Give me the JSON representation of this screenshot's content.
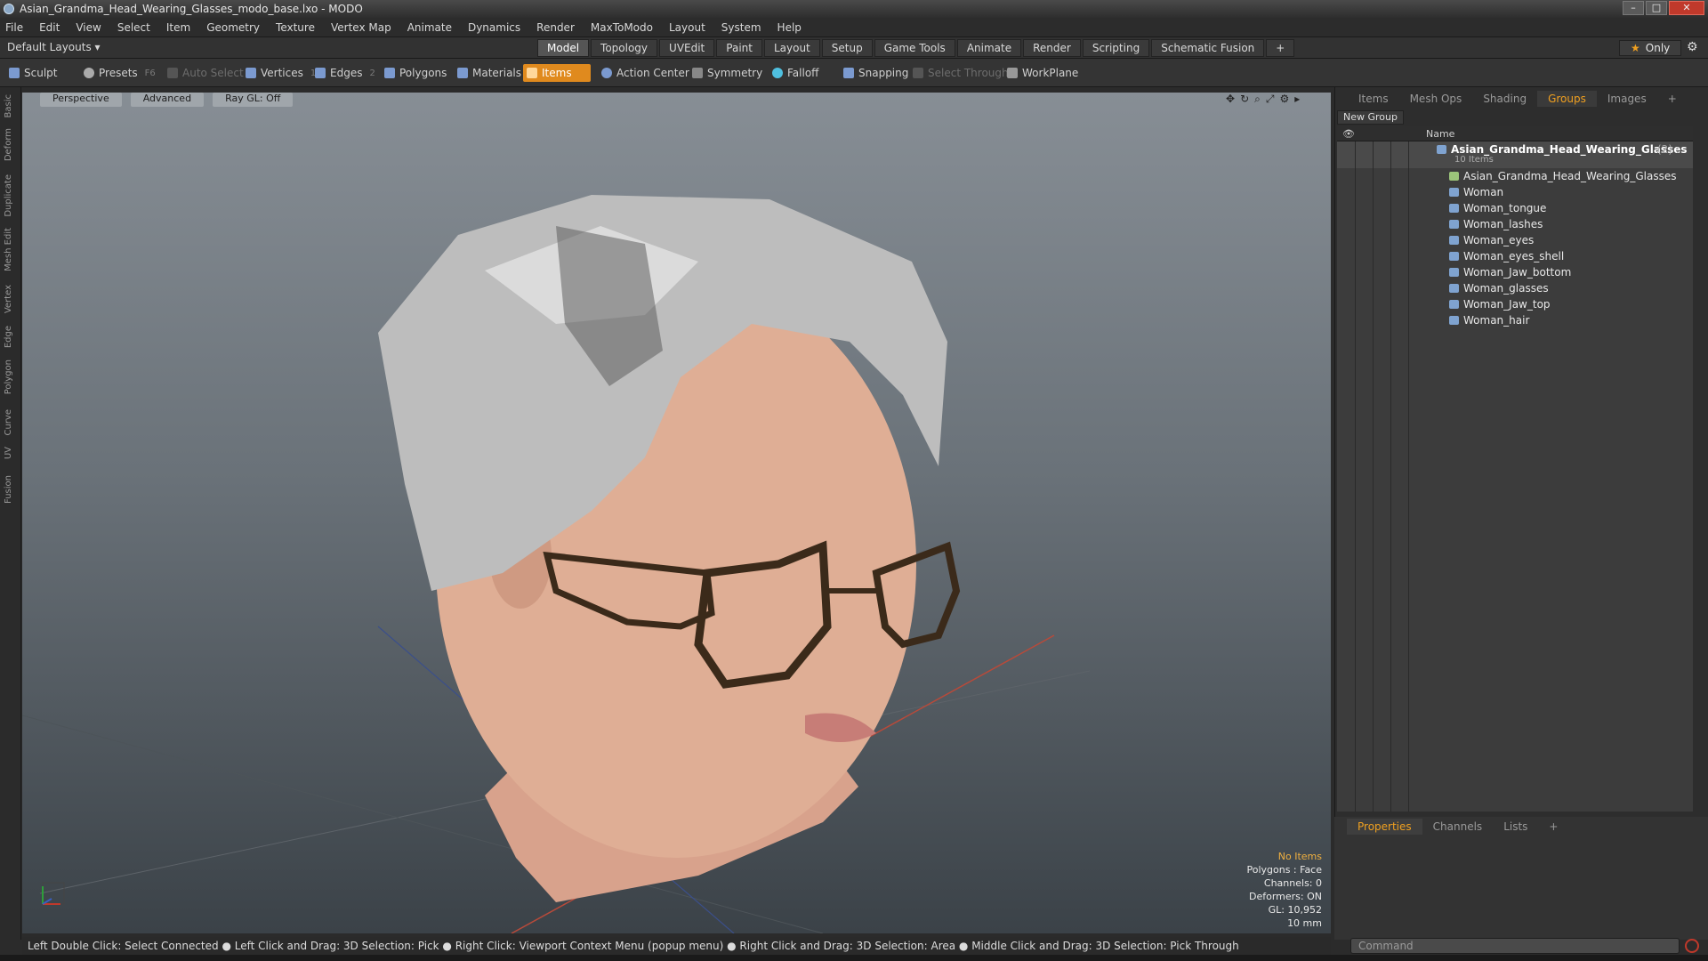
{
  "window": {
    "title": "Asian_Grandma_Head_Wearing_Glasses_modo_base.lxo - MODO"
  },
  "menu": [
    "File",
    "Edit",
    "View",
    "Select",
    "Item",
    "Geometry",
    "Texture",
    "Vertex Map",
    "Animate",
    "Dynamics",
    "Render",
    "MaxToModo",
    "Layout",
    "System",
    "Help"
  ],
  "layout": {
    "dropdown": "Default Layouts ▾",
    "tabs": [
      "Model",
      "Topology",
      "UVEdit",
      "Paint",
      "Layout",
      "Setup",
      "Game Tools",
      "Animate",
      "Render",
      "Scripting",
      "Schematic Fusion"
    ],
    "active_tab": "Model",
    "only_label": "Only"
  },
  "toolbar": {
    "sculpt": "Sculpt",
    "presets": "Presets",
    "presets_key": "F6",
    "auto_select": "Auto Select",
    "vertices": "Vertices",
    "vertices_key": "1",
    "edges": "Edges",
    "edges_key": "2",
    "polygons": "Polygons",
    "materials": "Materials",
    "items": "Items",
    "action_center": "Action Center",
    "symmetry": "Symmetry",
    "falloff": "Falloff",
    "snapping": "Snapping",
    "select_through": "Select Through",
    "workplane": "WorkPlane"
  },
  "left_tabs": [
    "Basic",
    "Deform",
    "Duplicate",
    "Mesh Edit",
    "Vertex",
    "Edge",
    "Polygon",
    "Curve",
    "UV",
    "Fusion"
  ],
  "viewport": {
    "view": "Perspective",
    "shading": "Advanced",
    "raygl": "Ray GL: Off",
    "stats": {
      "no_items": "No Items",
      "polygons": "Polygons : Face",
      "channels": "Channels: 0",
      "deformers": "Deformers: ON",
      "gl": "GL: 10,952",
      "unit": "10 mm"
    }
  },
  "right_panel": {
    "tabs": [
      "Items",
      "Mesh Ops",
      "Shading",
      "Groups",
      "Images"
    ],
    "active_tab": "Groups",
    "new_group": "New Group",
    "column_name": "Name",
    "group": {
      "name": "Asian_Grandma_Head_Wearing_Glasses",
      "count": "(2) :",
      "sub": "10 Items"
    },
    "items": [
      "Asian_Grandma_Head_Wearing_Glasses",
      "Woman",
      "Woman_tongue",
      "Woman_lashes",
      "Woman_eyes",
      "Woman_eyes_shell",
      "Woman_Jaw_bottom",
      "Woman_glasses",
      "Woman_Jaw_top",
      "Woman_hair"
    ]
  },
  "props_panel": {
    "tabs": [
      "Properties",
      "Channels",
      "Lists"
    ],
    "active_tab": "Properties"
  },
  "statusbar": "Left Double Click: Select Connected ● Left Click and Drag: 3D Selection: Pick ● Right Click: Viewport Context Menu (popup menu) ● Right Click and Drag: 3D Selection: Area ● Middle Click and Drag: 3D Selection: Pick Through",
  "command_placeholder": "Command",
  "colors": {
    "accent": "#e08a1e",
    "skin": "#d9a58e",
    "hair": "#cfcfcf",
    "glasses": "#3b2a1a"
  }
}
